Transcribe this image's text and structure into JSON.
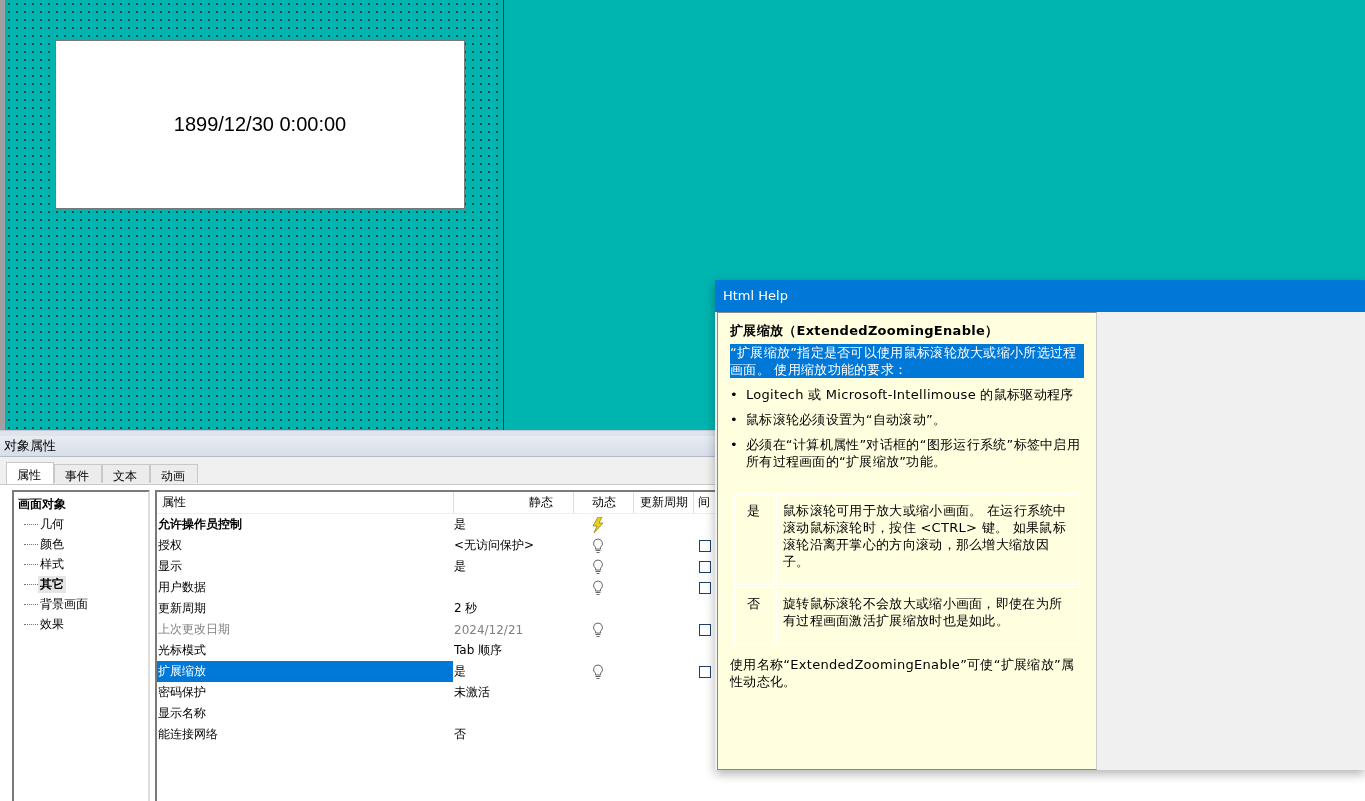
{
  "canvas": {
    "display_value": "1899/12/30 0:00:00"
  },
  "properties_panel": {
    "title": "对象属性",
    "tabs": [
      {
        "label": "属性",
        "selected": true
      },
      {
        "label": "事件",
        "selected": false
      },
      {
        "label": "文本",
        "selected": false
      },
      {
        "label": "动画",
        "selected": false
      }
    ],
    "tree": {
      "label": "画面对象",
      "children": [
        {
          "label": "几何",
          "selected": false
        },
        {
          "label": "颜色",
          "selected": false
        },
        {
          "label": "样式",
          "selected": false
        },
        {
          "label": "其它",
          "selected": true
        },
        {
          "label": "背景画面",
          "selected": false
        },
        {
          "label": "效果",
          "selected": false
        }
      ]
    },
    "table": {
      "columns": [
        "属性",
        "静态",
        "动态",
        "更新周期",
        "间"
      ],
      "rows": [
        {
          "name": "允许操作员控制",
          "static": "是",
          "dynamic_icon": {
            "kind": "lightning"
          },
          "bold": true,
          "disabled": false,
          "selected": false
        },
        {
          "name": "授权",
          "static": "<无访问保护>",
          "dynamic_icon": {
            "kind": "bulb"
          },
          "indirect": {
            "checked": false
          },
          "bold": false,
          "disabled": false,
          "selected": false
        },
        {
          "name": "显示",
          "static": "是",
          "dynamic_icon": {
            "kind": "bulb"
          },
          "indirect": {
            "checked": false
          },
          "bold": false,
          "disabled": false,
          "selected": false
        },
        {
          "name": "用户数据",
          "dynamic_icon": {
            "kind": "bulb"
          },
          "indirect": {
            "checked": false
          },
          "bold": false,
          "disabled": false,
          "selected": false
        },
        {
          "name": "更新周期",
          "static": "2 秒",
          "bold": false,
          "disabled": false,
          "selected": false
        },
        {
          "name": "上次更改日期",
          "static": "2024/12/21",
          "dynamic_icon": {
            "kind": "bulb"
          },
          "indirect": {
            "checked": false
          },
          "bold": false,
          "disabled": true,
          "selected": false
        },
        {
          "name": "光标模式",
          "static": "Tab 顺序",
          "bold": false,
          "disabled": false,
          "selected": false
        },
        {
          "name": "扩展缩放",
          "static": "是",
          "dynamic_icon": {
            "kind": "bulb"
          },
          "indirect": {
            "checked": false
          },
          "bold": false,
          "disabled": false,
          "selected": true
        },
        {
          "name": "密码保护",
          "static": "未激活",
          "bold": false,
          "disabled": false,
          "selected": false
        },
        {
          "name": "显示名称",
          "bold": false,
          "disabled": false,
          "selected": false
        },
        {
          "name": "能连接网络",
          "static": "否",
          "bold": false,
          "disabled": false,
          "selected": false
        }
      ]
    }
  },
  "help_window": {
    "title": "Html Help",
    "heading": "扩展缩放（ExtendedZoomingEnable）",
    "intro": {
      "text": "“扩展缩放”指定是否可以使用鼠标滚轮放大或缩小所选过程画面。 使用缩放功能的要求：",
      "selected": true
    },
    "bullets": [
      {
        "marker": "•",
        "text": "Logitech 或 Microsoft-Intellimouse 的鼠标驱动程序"
      },
      {
        "marker": "•",
        "text": "鼠标滚轮必须设置为“自动滚动”。"
      },
      {
        "marker": "•",
        "text": "必须在“计算机属性”对话框的“图形运行系统”标签中启用所有过程画面的“扩展缩放”功能。"
      }
    ],
    "table": [
      {
        "value": "是",
        "description": "鼠标滚轮可用于放大或缩小画面。 在运行系统中滚动鼠标滚轮时，按住 <CTRL> 键。 如果鼠标滚轮沿离开掌心的方向滚动，那么增大缩放因子。"
      },
      {
        "value": "否",
        "description": "旋转鼠标滚轮不会放大或缩小画面，即使在为所有过程画面激活扩展缩放时也是如此。"
      }
    ],
    "footer": "使用名称“ExtendedZoomingEnable”可使“扩展缩放”属性动态化。"
  }
}
